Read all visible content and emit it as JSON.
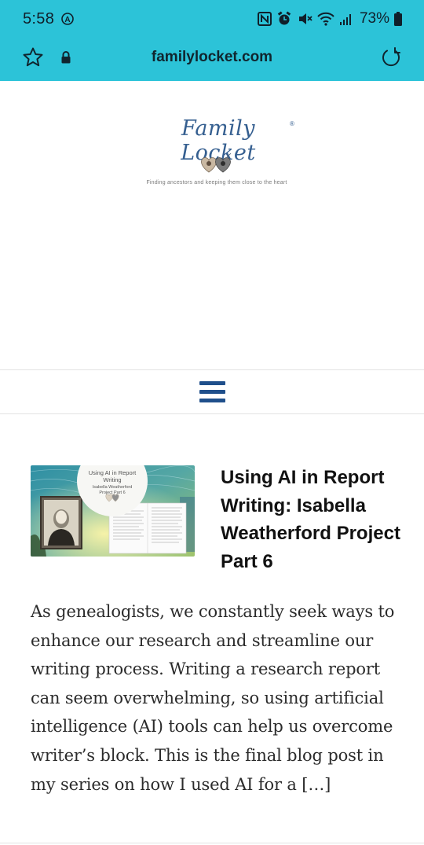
{
  "status_bar": {
    "time": "5:58",
    "battery": "73%",
    "icons": [
      "nfc-icon",
      "alarm-icon",
      "mute-icon",
      "wifi-icon",
      "signal-icon",
      "battery-icon"
    ]
  },
  "browser": {
    "url": "familylocket.com",
    "icons": [
      "star-bookmark-icon",
      "lock-icon",
      "reload-icon"
    ]
  },
  "site": {
    "logo_name": "Family Locket",
    "tagline": "Finding ancestors and keeping them close to the heart"
  },
  "nav": {
    "menu_icon": "hamburger-menu-icon"
  },
  "article": {
    "title": "Using AI in Report Writing: Isabella Weatherford Project Part 6",
    "excerpt": "As genealogists, we constantly seek ways to enhance our research and streamline our writing process. Writing a research report can seem overwhelming, so using artificial intelligence (AI) tools can help us overcome writer’s block. This is the final blog post in my series on how I used AI for a […]",
    "thumbnail": {
      "line1": "Using AI in Report",
      "line2": "Writing",
      "line3": "Isabella Weatherford",
      "line4": "Project Part 6"
    }
  },
  "colors": {
    "browser_bar": "#2cc3d8",
    "menu_icon": "#1f4f8b",
    "logo_text": "#355f90"
  }
}
